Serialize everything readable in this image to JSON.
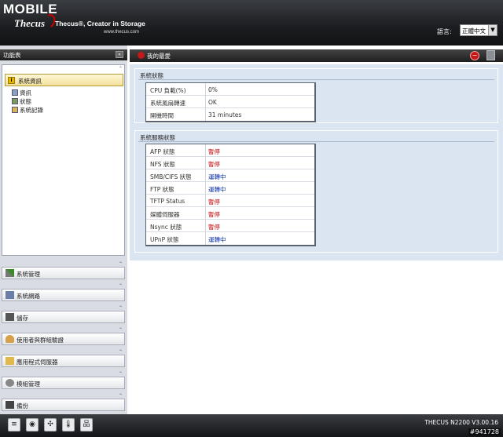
{
  "header": {
    "logo_mobile": "MOBILE",
    "logo_brand": "Thecus",
    "tagline": "Thecus®, Creator in Storage",
    "url": "www.thecus.com",
    "language_label": "語言:",
    "language_value": "正體中文"
  },
  "sidebar": {
    "title": "功能表",
    "collapse_symbol": "«",
    "open_section": {
      "title": "系統資訊",
      "links": [
        "資訊",
        "狀態",
        "系統記錄"
      ]
    },
    "items": [
      {
        "label": "系統管理"
      },
      {
        "label": "系統網路"
      },
      {
        "label": "儲存"
      },
      {
        "label": "使用者與群組驗證"
      },
      {
        "label": "應用程式伺服器"
      },
      {
        "label": "模組管理"
      },
      {
        "label": "備份"
      }
    ]
  },
  "main": {
    "title": "我的最愛",
    "system_status": {
      "title": "系統狀態",
      "rows": [
        {
          "key": "CPU 負載(%)",
          "value": "0%"
        },
        {
          "key": "系統風扇轉速",
          "value": "OK"
        },
        {
          "key": "開機時間",
          "value": "31 minutes"
        }
      ]
    },
    "service_status": {
      "title": "系統服務狀態",
      "rows": [
        {
          "key": "AFP 狀態",
          "value": "暫停",
          "state": "stopped"
        },
        {
          "key": "NFS 狀態",
          "value": "暫停",
          "state": "stopped"
        },
        {
          "key": "SMB/CIFS 狀態",
          "value": "運轉中",
          "state": "running"
        },
        {
          "key": "FTP 狀態",
          "value": "運轉中",
          "state": "running"
        },
        {
          "key": "TFTP Status",
          "value": "暫停",
          "state": "stopped"
        },
        {
          "key": "媒體伺服器",
          "value": "暫停",
          "state": "stopped"
        },
        {
          "key": "Nsync 狀態",
          "value": "暫停",
          "state": "stopped"
        },
        {
          "key": "UPnP 狀態",
          "value": "運轉中",
          "state": "running"
        }
      ]
    }
  },
  "footer": {
    "version": "THECUS N2200 V3.00.16",
    "watermark": "#941728"
  },
  "colors": {
    "stopped": "#c00000",
    "running": "#0a2fa0",
    "panel_bg": "#dae5f1"
  }
}
